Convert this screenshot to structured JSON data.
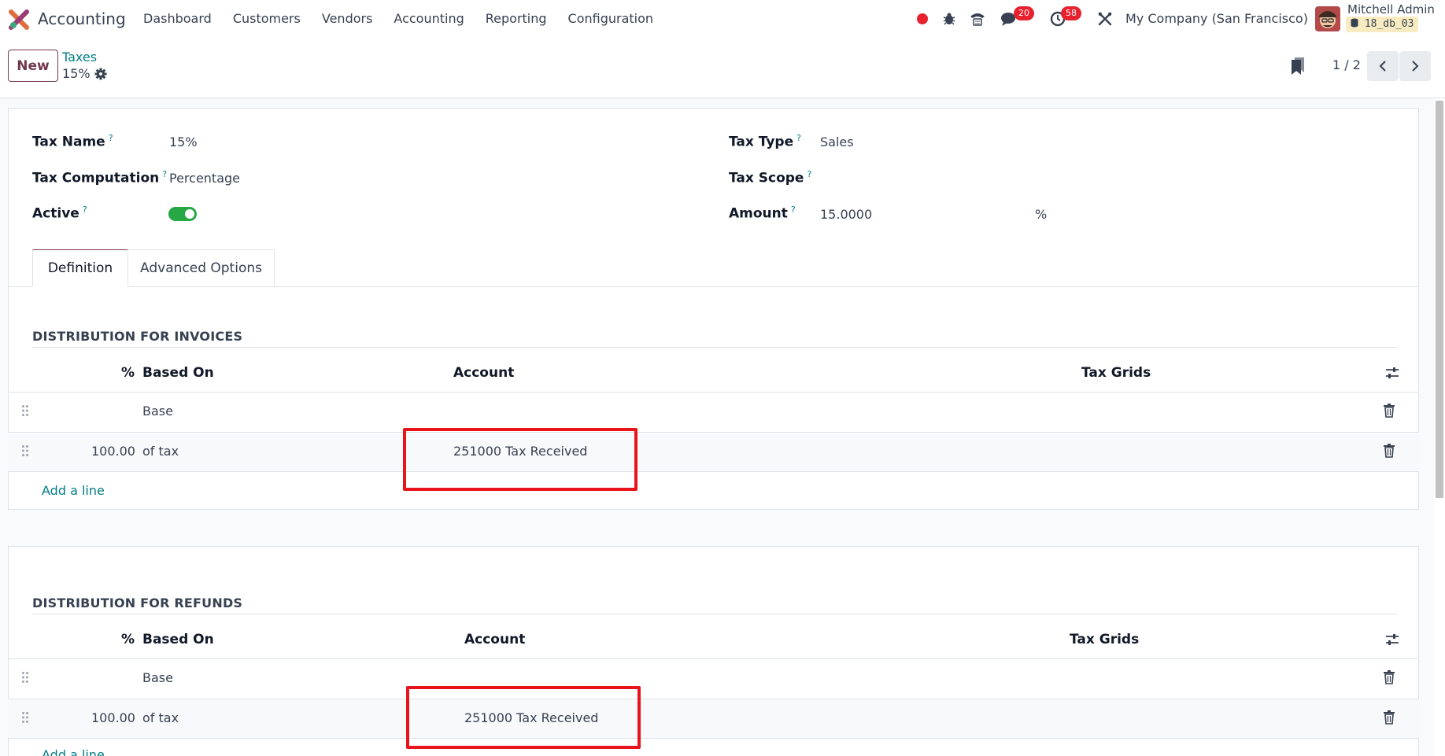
{
  "navbar": {
    "app_name": "Accounting",
    "menu": [
      "Dashboard",
      "Customers",
      "Vendors",
      "Accounting",
      "Reporting",
      "Configuration"
    ],
    "messages_count": "20",
    "activities_count": "58",
    "company": "My Company (San Francisco)",
    "user_name": "Mitchell Admin",
    "db_name": "18_db_03"
  },
  "control_panel": {
    "new_label": "New",
    "breadcrumb_parent": "Taxes",
    "breadcrumb_current": "15%",
    "pager_value": "1 / 2"
  },
  "form": {
    "tax_name_label": "Tax Name",
    "tax_name_value": "15%",
    "tax_computation_label": "Tax Computation",
    "tax_computation_value": "Percentage",
    "active_label": "Active",
    "active_value": true,
    "tax_type_label": "Tax Type",
    "tax_type_value": "Sales",
    "tax_scope_label": "Tax Scope",
    "tax_scope_value": "",
    "amount_label": "Amount",
    "amount_value": "15.0000",
    "amount_unit": "%",
    "help_mark": "?"
  },
  "tabs": [
    "Definition",
    "Advanced Options"
  ],
  "invoices": {
    "title": "DISTRIBUTION FOR INVOICES",
    "headers": {
      "percent": "%",
      "based_on": "Based On",
      "account": "Account",
      "tax_grids": "Tax Grids"
    },
    "rows": [
      {
        "percent": "",
        "based_on": "Base",
        "account": "",
        "tax_grids": ""
      },
      {
        "percent": "100.00",
        "based_on": "of tax",
        "account": "251000 Tax Received",
        "tax_grids": ""
      }
    ],
    "add_line": "Add a line"
  },
  "refunds": {
    "title": "DISTRIBUTION FOR REFUNDS",
    "headers": {
      "percent": "%",
      "based_on": "Based On",
      "account": "Account",
      "tax_grids": "Tax Grids"
    },
    "rows": [
      {
        "percent": "",
        "based_on": "Base",
        "account": "",
        "tax_grids": ""
      },
      {
        "percent": "100.00",
        "based_on": "of tax",
        "account": "251000 Tax Received",
        "tax_grids": ""
      }
    ],
    "add_line": "Add a line"
  },
  "colors": {
    "brand": "#71394f",
    "link": "#017e84",
    "toggle_on": "#28a745",
    "highlight": "#e8141b",
    "badge": "#e7212e"
  }
}
